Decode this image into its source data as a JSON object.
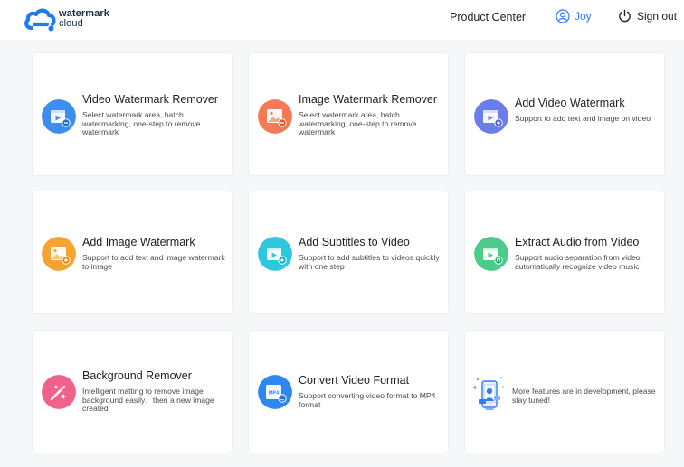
{
  "brand": {
    "line1": "watermark",
    "line2": "cloud"
  },
  "nav": {
    "product_center": "Product Center",
    "user_name": "Joy",
    "sign_out": "Sign out"
  },
  "colors": {
    "accent": "#2f7cf6",
    "blue": "#3d8cf0",
    "orange": "#f27a55",
    "indigo": "#6b7de8",
    "amber": "#f5a431",
    "cyan": "#2ec7dd",
    "green": "#4ccb8a",
    "pink": "#f0628b",
    "blue2": "#2c88f0"
  },
  "cards": [
    {
      "title": "Video Watermark Remover",
      "description": "Select watermark area, batch watermarking, one-step to remove watermark",
      "icon": "video-remove-icon"
    },
    {
      "title": "Image Watermark Remover",
      "description": "Select watermark area, batch watermarking, one-step to remove watermark",
      "icon": "image-remove-icon"
    },
    {
      "title": "Add Video Watermark",
      "description": "Support to add text and image on video",
      "icon": "video-add-icon"
    },
    {
      "title": "Add Image Watermark",
      "description": "Support to add text and image watermark to image",
      "icon": "image-add-icon"
    },
    {
      "title": "Add Subtitles to Video",
      "description": "Support to add subtitles to videos quickly with one step",
      "icon": "subtitle-icon"
    },
    {
      "title": "Extract Audio from Video",
      "description": "Support audio separation from video, automatically recognize video music",
      "icon": "audio-extract-icon"
    },
    {
      "title": "Background Remover",
      "description": "Intelligent matting to remove image background easily，then a new image created",
      "icon": "magic-wand-icon"
    },
    {
      "title": "Convert Video Format",
      "description": "Support converting video format to MP4 format",
      "icon": "mp4-icon",
      "badge": "MP4"
    },
    {
      "description": "More features are in development, please stay tuned!",
      "icon": "phone-illustration-icon"
    }
  ]
}
